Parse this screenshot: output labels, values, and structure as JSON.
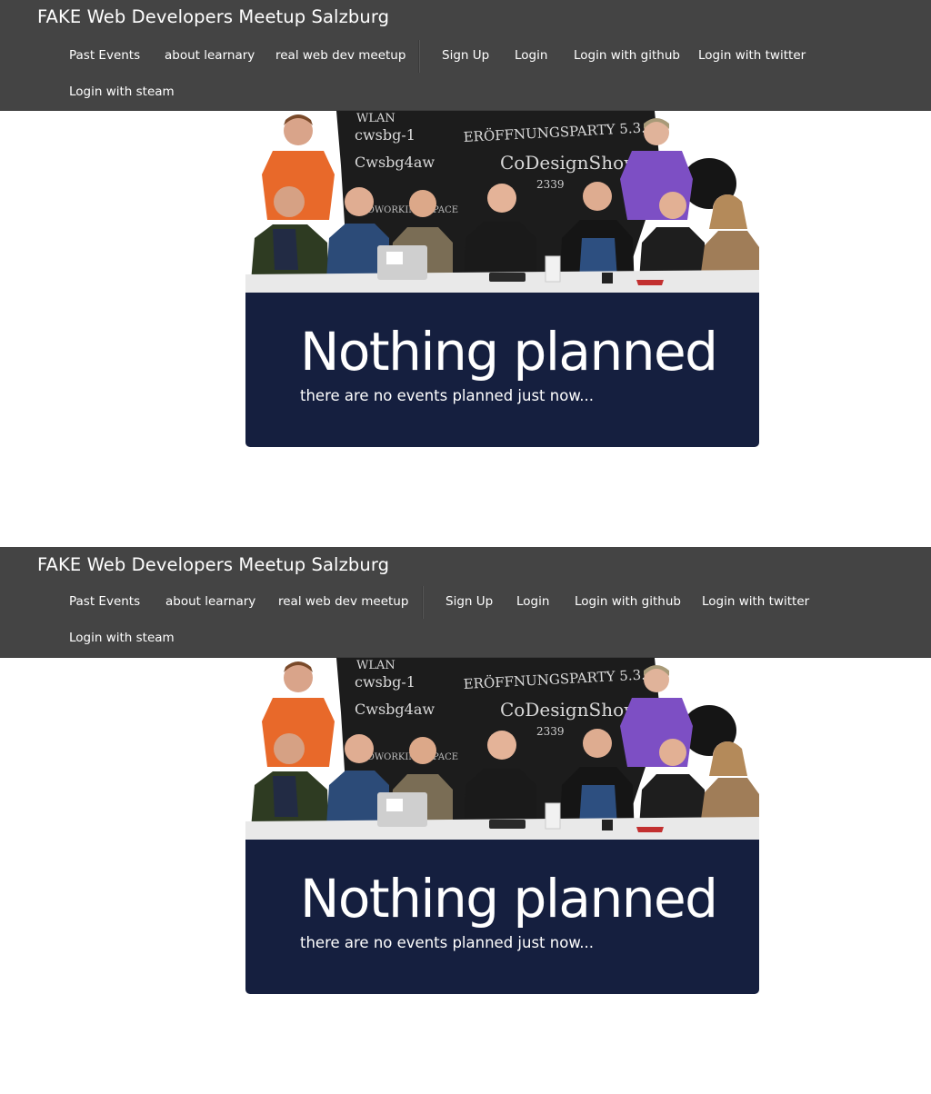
{
  "site": {
    "brand": "FAKE Web Developers Meetup Salzburg"
  },
  "nav": {
    "past_events": "Past Events",
    "about": "about learnary",
    "real_meetup": "real web dev meetup",
    "sign_up": "Sign Up",
    "login": "Login",
    "login_github": "Login with github",
    "login_twitter": "Login with twitter",
    "login_steam": "Login with steam"
  },
  "hero": {
    "image": "group-photo-of-meetup-members",
    "chalkboard_lines": [
      "WLAN",
      "cwsbg-1",
      "Cwsbg4aw",
      "ERÖFFNUNGSPARTY 5.3.",
      "CoDesignShow",
      "2339",
      "COWORKING SPACE"
    ]
  },
  "event": {
    "title": "Nothing planned",
    "subtitle": "there are no events planned just now..."
  },
  "colors": {
    "navbar": "#444444",
    "panel": "#151f3f",
    "text": "#ffffff"
  }
}
